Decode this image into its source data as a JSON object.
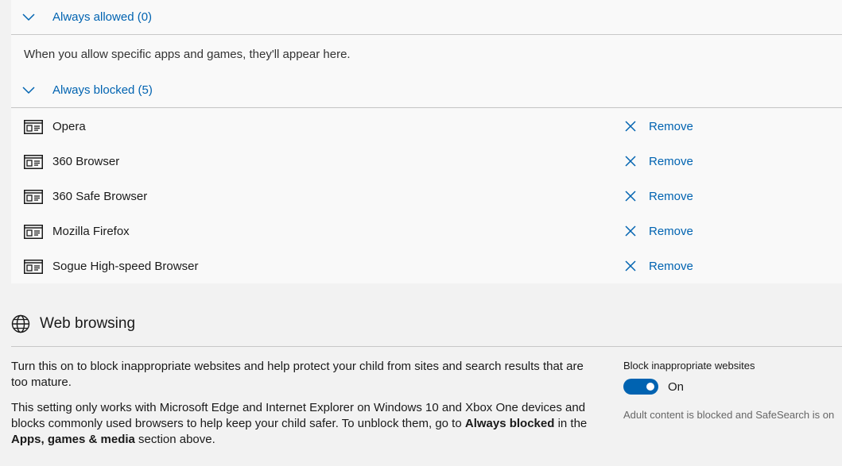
{
  "always_allowed": {
    "title": "Always allowed (0)",
    "empty_message": "When you allow specific apps and games, they'll appear here."
  },
  "always_blocked": {
    "title": "Always blocked (5)",
    "apps": [
      {
        "name": "Opera",
        "action": "Remove"
      },
      {
        "name": "360 Browser",
        "action": "Remove"
      },
      {
        "name": "360 Safe Browser",
        "action": "Remove"
      },
      {
        "name": "Mozilla Firefox",
        "action": "Remove"
      },
      {
        "name": "Sogue High-speed Browser",
        "action": "Remove"
      }
    ]
  },
  "web_browsing": {
    "title": "Web browsing",
    "description_1": "Turn this on to block inappropriate websites and help protect your child from sites and search results that are too mature.",
    "description_2_a": "This setting only works with Microsoft Edge and Internet Explorer on Windows 10 and Xbox One devices and blocks commonly used browsers to help keep your child safer. To unblock them, go to ",
    "description_2_bold_1": "Always blocked",
    "description_2_b": " in the ",
    "description_2_bold_2": "Apps, games & media",
    "description_2_c": " section above.",
    "toggle_label": "Block inappropriate websites",
    "toggle_state": "On",
    "toggle_note": "Adult content is blocked and SafeSearch is on"
  },
  "colors": {
    "accent": "#0063b1",
    "panel_bg": "#f9f9f9",
    "page_bg": "#f2f2f2"
  },
  "icons": {
    "chevron": "chevron-down-icon",
    "app": "app-window-icon",
    "remove": "close-icon",
    "web": "globe-icon"
  }
}
